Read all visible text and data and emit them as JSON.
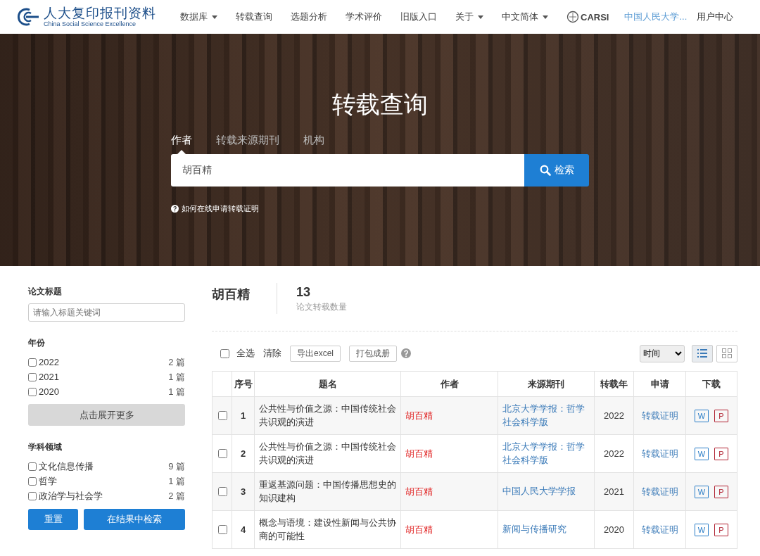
{
  "header": {
    "logo_title": "人大复印报刊资料",
    "logo_subtitle": "China Social Science Excellence",
    "nav": [
      {
        "label": "数据库",
        "dropdown": true
      },
      {
        "label": "转载查询",
        "dropdown": false
      },
      {
        "label": "选题分析",
        "dropdown": false
      },
      {
        "label": "学术评价",
        "dropdown": false
      },
      {
        "label": "旧版入口",
        "dropdown": false
      },
      {
        "label": "关于",
        "dropdown": true
      },
      {
        "label": "中文简体",
        "dropdown": true
      }
    ],
    "carsi": "CARSI",
    "institution": "中国人民大学...",
    "user": "用户中心"
  },
  "hero": {
    "title": "转载查询",
    "tabs": [
      {
        "label": "作者",
        "selected": true
      },
      {
        "label": "转载来源期刊",
        "selected": false
      },
      {
        "label": "机构",
        "selected": false
      }
    ],
    "search_value": "胡百精",
    "search_button": "检索",
    "help": "如何在线申请转载证明"
  },
  "sidebar": {
    "title_filter": {
      "label": "论文标题",
      "placeholder": "请输入标题关键词"
    },
    "year": {
      "label": "年份",
      "options": [
        {
          "label": "2022",
          "count": "2 篇",
          "checked": false
        },
        {
          "label": "2021",
          "count": "1 篇",
          "checked": false
        },
        {
          "label": "2020",
          "count": "1 篇",
          "checked": false
        }
      ],
      "expand": "点击展开更多"
    },
    "subject": {
      "label": "学科领域",
      "options": [
        {
          "label": "文化信息传播",
          "count": "9 篇",
          "checked": false
        },
        {
          "label": "哲学",
          "count": "1 篇",
          "checked": false
        },
        {
          "label": "政治学与社会学",
          "count": "2 篇",
          "checked": false
        }
      ]
    },
    "buttons": [
      "重置",
      "在结果中检索"
    ]
  },
  "results": {
    "author": "胡百精",
    "count": "13",
    "count_label": "论文转载数量",
    "toolbar": {
      "select_all": {
        "label": "全选",
        "checked": false
      },
      "clear": "清除",
      "export": "导出excel",
      "pack": "打包成册",
      "sort": "时间",
      "views": [
        {
          "kind": "list",
          "selected": true
        },
        {
          "kind": "grid",
          "selected": false
        }
      ]
    },
    "table": {
      "columns": [
        "序号",
        "题名",
        "作者",
        "来源期刊",
        "转载年",
        "申请",
        "下载"
      ],
      "rows": [
        {
          "checked": false,
          "index": "1",
          "title": "公共性与价值之源：中国传统社会共识观的演进",
          "author": "胡百精",
          "journal": "北京大学学报：哲学社会科学版",
          "year": "2022",
          "action": "转载证明",
          "downloads": [
            {
              "label": "W",
              "kind": "word"
            },
            {
              "label": "P",
              "kind": "pdf"
            }
          ]
        },
        {
          "checked": false,
          "index": "2",
          "title": "公共性与价值之源：中国传统社会共识观的演进",
          "author": "胡百精",
          "journal": "北京大学学报：哲学社会科学版",
          "year": "2022",
          "action": "转载证明",
          "downloads": [
            {
              "label": "W",
              "kind": "word"
            },
            {
              "label": "P",
              "kind": "pdf"
            }
          ]
        },
        {
          "checked": false,
          "index": "3",
          "title": "重返基源问题：中国传播思想史的知识建构",
          "author": "胡百精",
          "journal": "中国人民大学学报",
          "year": "2021",
          "action": "转载证明",
          "downloads": [
            {
              "label": "W",
              "kind": "word"
            },
            {
              "label": "P",
              "kind": "pdf"
            }
          ]
        },
        {
          "checked": false,
          "index": "4",
          "title": "概念与语境：建设性新闻与公共协商的可能性",
          "author": "胡百精",
          "journal": "新闻与传播研究",
          "year": "2020",
          "action": "转载证明",
          "downloads": [
            {
              "label": "W",
              "kind": "word"
            },
            {
              "label": "P",
              "kind": "pdf"
            }
          ]
        }
      ]
    }
  }
}
